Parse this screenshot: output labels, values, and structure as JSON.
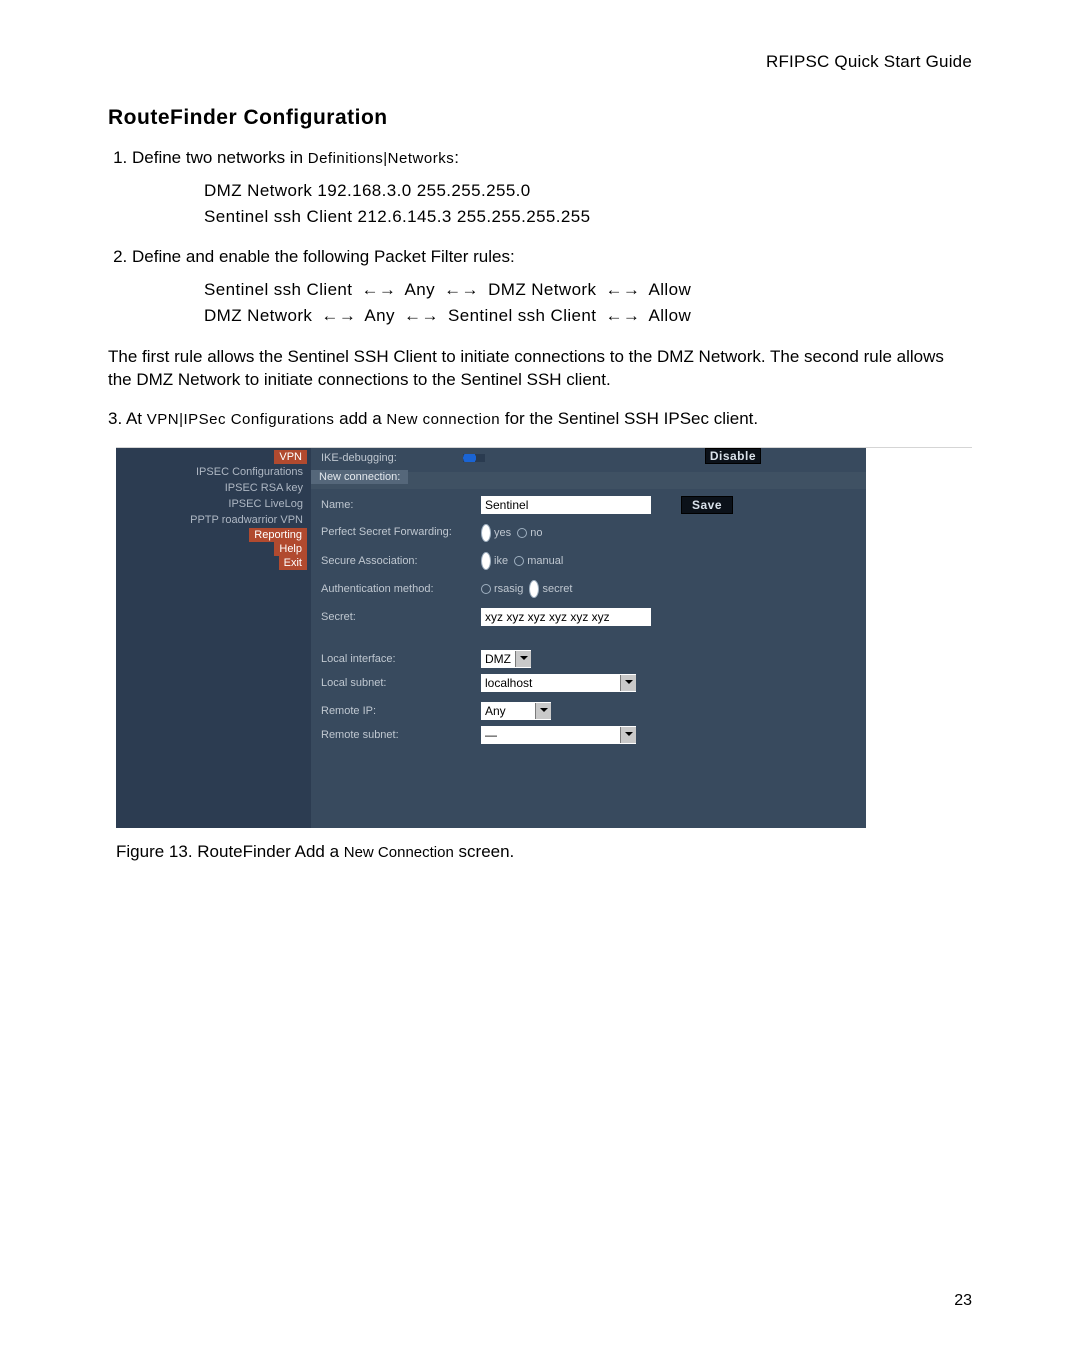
{
  "header": {
    "running": "RFIPSC Quick Start Guide"
  },
  "section": {
    "title": "RouteFinder Configuration"
  },
  "steps": {
    "s1": {
      "lead": "Define two networks in ",
      "where": "Definitions|Networks",
      "tail": ":",
      "net1": "DMZ Network   192.168.3.0  255.255.255.0",
      "net2": "Sentinel ssh Client  212.6.145.3  255.255.255.255"
    },
    "s2": {
      "text": "Define and enable the following Packet Filter rules:",
      "rule1": {
        "a": "Sentinel ssh Client",
        "b": "Any",
        "c": "DMZ Network",
        "d": "Allow"
      },
      "rule2": {
        "a": "DMZ Network",
        "b": "Any",
        "c": "Sentinel ssh Client",
        "d": "Allow"
      }
    },
    "s3": {
      "pre": "At ",
      "path": "VPN|IPSec Configurations",
      "mid": " add a ",
      "action": "New connection",
      "post": " for the Sentinel SSH IPSec client."
    }
  },
  "arrow": "←→",
  "para1": "The first rule allows the Sentinel SSH Client to initiate connections to the DMZ Network. The second rule allows the DMZ Network to initiate connections to the Sentinel SSH client.",
  "figure": {
    "caption_lead": "Figure 13.  RouteFinder Add a ",
    "caption_term": "New Connection",
    "caption_tail": " screen."
  },
  "pagenum": "23",
  "shot": {
    "side": {
      "items": [
        "VPN",
        "IPSEC Configurations",
        "IPSEC RSA key",
        "IPSEC LiveLog",
        "PPTP roadwarrior VPN",
        "Reporting",
        "Help",
        "Exit"
      ],
      "highlight": [
        0,
        5,
        6,
        7
      ]
    },
    "ike": {
      "label": "IKE-debugging:"
    },
    "btn_disable": "Disable",
    "tab": "New connection:",
    "form": {
      "name_label": "Name:",
      "name_value": "Sentinel",
      "save": "Save",
      "pfs_label": "Perfect Secret Forwarding:",
      "pfs_yes": "yes",
      "pfs_no": "no",
      "sa_label": "Secure Association:",
      "sa_ike": "ike",
      "sa_manual": "manual",
      "auth_label": "Authentication method:",
      "auth_rsasig": "rsasig",
      "auth_secret": "secret",
      "secret_label": "Secret:",
      "secret_value": "xyz xyz xyz xyz xyz xyz",
      "liface_label": "Local interface:",
      "liface_value": "DMZ",
      "lsubnet_label": "Local subnet:",
      "lsubnet_value": "localhost",
      "rip_label": "Remote IP:",
      "rip_value": "Any",
      "rsubnet_label": "Remote subnet:",
      "rsubnet_value": "—"
    }
  }
}
